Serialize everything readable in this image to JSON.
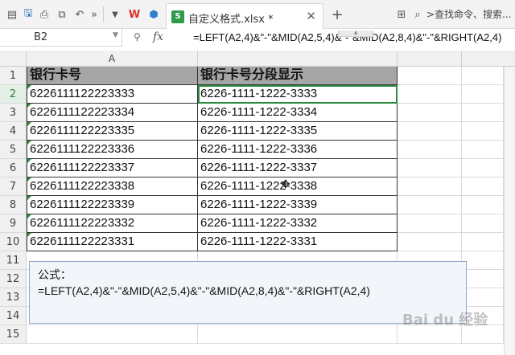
{
  "title_bar": {
    "tab_label": "自定义格式.xlsx *",
    "tab_icon_text": "S",
    "search_label": ">查找命令、搜索..."
  },
  "formula_bar": {
    "cell_ref": "B2",
    "fx_label": "fx",
    "formula": "=LEFT(A2,4)&\"-\"&MID(A2,5,4)&\"-\"&MID(A2,8,4)&\"-\"&RIGHT(A2,4)"
  },
  "sheet": {
    "columns": [
      "A",
      ""
    ],
    "row_numbers": [
      "1",
      "2",
      "3",
      "4",
      "5",
      "6",
      "7",
      "8",
      "9",
      "10",
      "11",
      "12",
      "13",
      "14",
      "15"
    ],
    "active_row": "2",
    "header": [
      "银行卡号",
      "银行卡号分段显示"
    ],
    "rows": [
      [
        "6226111122223333",
        "6226-1111-1222-3333"
      ],
      [
        "6226111122223334",
        "6226-1111-1222-3334"
      ],
      [
        "6226111122223335",
        "6226-1111-1222-3335"
      ],
      [
        "6226111122223336",
        "6226-1111-1222-3336"
      ],
      [
        "6226111122223337",
        "6226-1111-1222-3337"
      ],
      [
        "6226111122223338",
        "6226-1111-1222-3338"
      ],
      [
        "6226111122223339",
        "6226-1111-1222-3339"
      ],
      [
        "6226111122223332",
        "6226-1111-1222-3332"
      ],
      [
        "6226111122223331",
        "6226-1111-1222-3331"
      ]
    ]
  },
  "note": {
    "label": "公式：",
    "formula": "=LEFT(A2,4)&\"-\"&MID(A2,5,4)&\"-\"&MID(A2,8,4)&\"-\"&RIGHT(A2,4)"
  },
  "watermark": "Bai du 经验",
  "colors": {
    "header_fill": "#a6a6a6",
    "selection": "#2b8a3e",
    "note_border": "#8aa3c2"
  }
}
